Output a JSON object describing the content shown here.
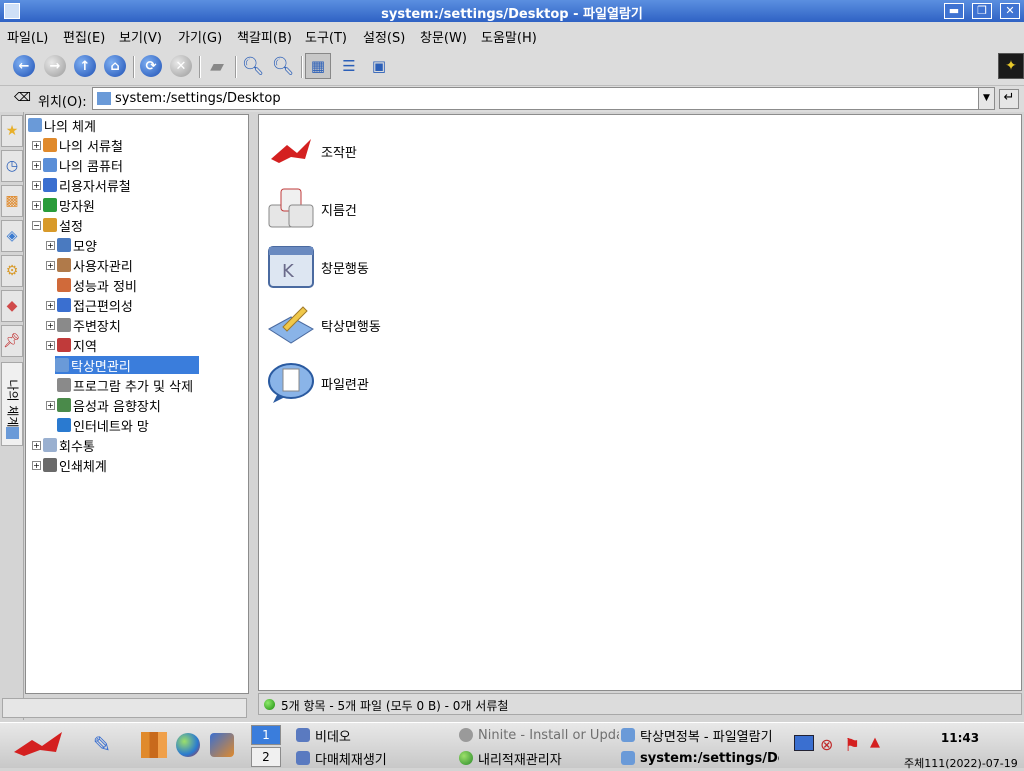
{
  "window": {
    "title": "system:/settings/Desktop - 파일열람기",
    "buttons": {
      "minimize": "▬",
      "maximize": "❐",
      "close": "✕"
    }
  },
  "menu": [
    "파일(L)",
    "편집(E)",
    "보기(V)",
    "가기(G)",
    "책갈피(B)",
    "도구(T)",
    "설정(S)",
    "창문(W)",
    "도움말(H)"
  ],
  "toolbar": {
    "icons": [
      "back-icon",
      "forward-icon",
      "up-icon",
      "home-icon",
      "reload-icon",
      "stop-icon",
      "print-icon",
      "zoom-in-icon",
      "zoom-out-icon",
      "icon-view-icon",
      "detail-view-icon",
      "preview-icon"
    ]
  },
  "location": {
    "label": "위치(O):",
    "path": "system:/settings/Desktop"
  },
  "tree": {
    "root": "나의 체계",
    "items": [
      {
        "label": "나의 서류철",
        "level": 1,
        "expandable": true,
        "icon_color": "#e08a2c"
      },
      {
        "label": "나의 콤퓨터",
        "level": 1,
        "expandable": true,
        "icon_color": "#5b8fd8"
      },
      {
        "label": "리용자서류철",
        "level": 1,
        "expandable": true,
        "icon_color": "#3a6fd0"
      },
      {
        "label": "망자원",
        "level": 1,
        "expandable": true,
        "icon_color": "#2a9c3a"
      },
      {
        "label": "설정",
        "level": 1,
        "expandable": true,
        "expanded": true,
        "icon_color": "#d89a2a"
      },
      {
        "label": "모양",
        "level": 2,
        "expandable": true,
        "icon_color": "#4a7ac0"
      },
      {
        "label": "사용자관리",
        "level": 2,
        "expandable": true,
        "icon_color": "#b07a4a"
      },
      {
        "label": "성능과 정비",
        "level": 2,
        "expandable": false,
        "icon_color": "#d06a3a"
      },
      {
        "label": "접근편의성",
        "level": 2,
        "expandable": true,
        "icon_color": "#3a6fd0"
      },
      {
        "label": "주변장치",
        "level": 2,
        "expandable": true,
        "icon_color": "#8a8a8a"
      },
      {
        "label": "지역",
        "level": 2,
        "expandable": true,
        "icon_color": "#c03a3a"
      },
      {
        "label": "탁상면관리",
        "level": 2,
        "expandable": false,
        "selected": true,
        "icon_color": "#6a9ad8"
      },
      {
        "label": "프로그람 추가 및 삭제",
        "level": 2,
        "expandable": false,
        "icon_color": "#8a8a8a"
      },
      {
        "label": "음성과 음향장치",
        "level": 2,
        "expandable": true,
        "icon_color": "#4a8a4a"
      },
      {
        "label": "인터네트와 망",
        "level": 2,
        "expandable": false,
        "icon_color": "#2a7ad0"
      },
      {
        "label": "회수통",
        "level": 1,
        "expandable": true,
        "icon_color": "#9ab0d0"
      },
      {
        "label": "인쇄체계",
        "level": 1,
        "expandable": true,
        "icon_color": "#6a6a6a"
      }
    ]
  },
  "sidebar_tab_label": "나의 체계",
  "icons": [
    {
      "label": "조작판",
      "icon": "control-panel-icon"
    },
    {
      "label": "지름건",
      "icon": "shortcut-keys-icon"
    },
    {
      "label": "창문행동",
      "icon": "window-behavior-icon"
    },
    {
      "label": "탁상면행동",
      "icon": "desktop-behavior-icon"
    },
    {
      "label": "파일련관",
      "icon": "file-association-icon"
    }
  ],
  "status": "5개 항목 - 5개 파일 (모두 0 B) - 0개 서류철",
  "taskbar": {
    "pager": [
      "1",
      "2"
    ],
    "tasks": [
      {
        "label": "비데오",
        "col": 0,
        "row": 0
      },
      {
        "label": "다매체재생기",
        "col": 0,
        "row": 1
      },
      {
        "label": "Ninite - Install or Update",
        "col": 1,
        "row": 0
      },
      {
        "label": "내리적재관리자",
        "col": 1,
        "row": 1
      },
      {
        "label": "탁상면정복 - 파일열람기",
        "col": 2,
        "row": 0
      },
      {
        "label": "system:/settings/Desktop",
        "col": 2,
        "row": 1,
        "active": true
      }
    ],
    "clock": "11:43",
    "date": "주체111(2022)-07-19"
  }
}
